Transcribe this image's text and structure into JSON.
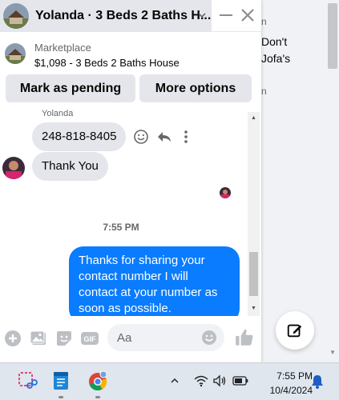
{
  "chat": {
    "title": "Yolanda · 3 Beds 2 Baths H...",
    "listing_source": "Marketplace",
    "listing_title": "$1,098 - 3 Beds 2 Baths House",
    "actions": {
      "mark_pending": "Mark as pending",
      "more_options": "More options"
    },
    "sender_name": "Yolanda",
    "messages": [
      {
        "direction": "in",
        "text": "248-818-8405"
      },
      {
        "direction": "in",
        "text": "Thank You"
      }
    ],
    "timestamp": "7:55 PM",
    "outgoing_message": "Thanks for sharing your contact number I will contact at your number as soon as possible.",
    "input_placeholder": "Aa"
  },
  "background_page": {
    "top_fragment": "n",
    "lines": [
      "Don't",
      "Jofa's"
    ],
    "mid_fragment": "n"
  },
  "taskbar": {
    "time": "7:55 PM",
    "date": "10/4/2024"
  },
  "colors": {
    "messenger_blue": "#0a7cff",
    "bubble_gray": "#e4e6eb",
    "like_blue": "#0866ff"
  }
}
